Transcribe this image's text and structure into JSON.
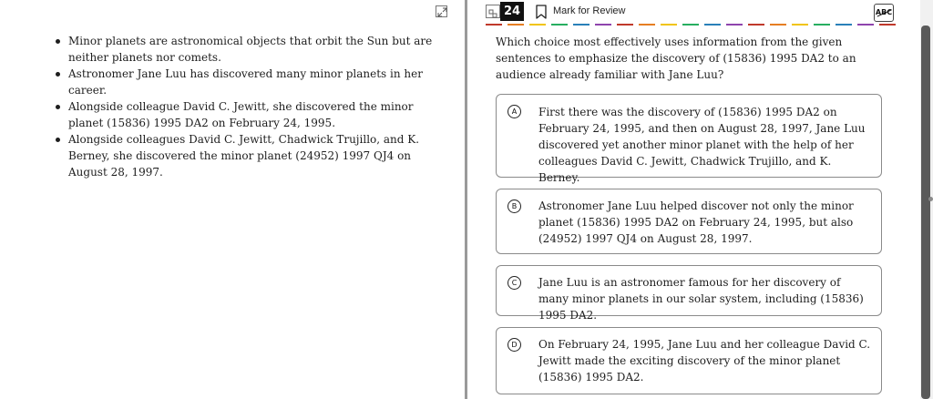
{
  "passage": {
    "bullets": [
      "Minor planets are astronomical objects that orbit the Sun but are neither planets nor comets.",
      "Astronomer Jane Luu has discovered many minor planets in her career.",
      "Alongside colleague David C. Jewitt, she discovered the minor planet (15836) 1995 DA2 on February 24, 1995.",
      "Alongside colleagues David C. Jewitt, Chadwick Trujillo, and K. Berney, she discovered the minor planet (24952) 1997 QJ4 on August 28, 1997."
    ]
  },
  "header": {
    "question_number": "24",
    "mark_for_review_label": "Mark for Review",
    "abc_label": "ABC"
  },
  "colors": {
    "dash_bar": [
      "#c0392b",
      "#e67e22",
      "#f1c40f",
      "#27ae60",
      "#2980b9",
      "#8e44ad"
    ]
  },
  "question": {
    "prompt": "Which choice most effectively uses information from the given sentences to emphasize the discovery of (15836) 1995 DA2 to an audience already familiar with Jane Luu?",
    "options": [
      {
        "letter": "A",
        "text": "First there was the discovery of (15836) 1995 DA2 on February 24, 1995, and then on August 28, 1997, Jane Luu discovered yet another minor planet with the help of her colleagues David C. Jewitt, Chadwick Trujillo, and K. Berney."
      },
      {
        "letter": "B",
        "text": "Astronomer Jane Luu helped discover not only the minor planet (15836) 1995 DA2 on February 24, 1995, but also (24952) 1997 QJ4 on August 28, 1997."
      },
      {
        "letter": "C",
        "text": "Jane Luu is an astronomer famous for her discovery of many minor planets in our solar system, including (15836) 1995 DA2."
      },
      {
        "letter": "D",
        "text": "On February 24, 1995, Jane Luu and her colleague David C. Jewitt made the exciting discovery of the minor planet (15836) 1995 DA2."
      }
    ]
  }
}
